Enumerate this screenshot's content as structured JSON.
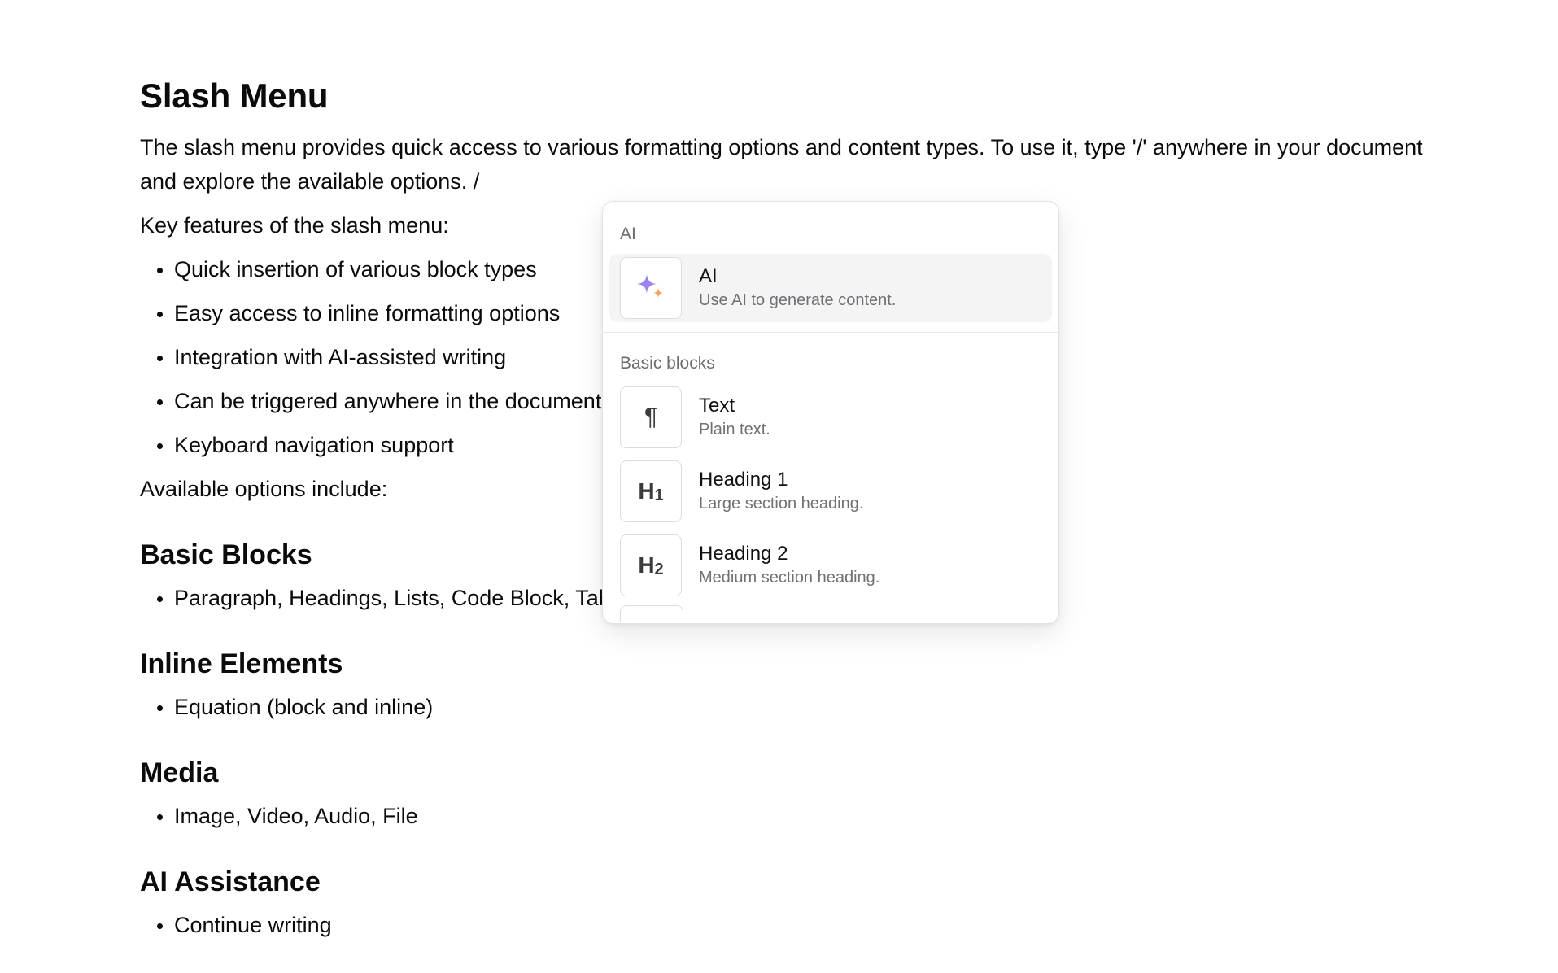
{
  "document": {
    "title": "Slash Menu",
    "intro": "The slash menu provides quick access to various formatting options and content types. To use it, type '/' anywhere in your document and explore the available options. /",
    "features_heading": "Key features of the slash menu:",
    "features": [
      "Quick insertion of various block types",
      "Easy access to inline formatting options",
      "Integration with AI-assisted writing",
      "Can be triggered anywhere in the document",
      "Keyboard navigation support"
    ],
    "options_heading": "Available options include:",
    "sections": [
      {
        "heading": "Basic Blocks",
        "items": [
          "Paragraph, Headings, Lists, Code Block, Table, Callout"
        ]
      },
      {
        "heading": "Inline Elements",
        "items": [
          "Equation (block and inline)"
        ]
      },
      {
        "heading": "Media",
        "items": [
          "Image, Video, Audio, File"
        ]
      },
      {
        "heading": "AI Assistance",
        "items": [
          "Continue writing"
        ]
      }
    ]
  },
  "slash_menu": {
    "groups": [
      {
        "label": "AI",
        "items": [
          {
            "icon": "ai-sparkle-icon",
            "title": "AI",
            "description": "Use AI to generate content.",
            "active": true
          }
        ]
      },
      {
        "label": "Basic blocks",
        "items": [
          {
            "icon": "paragraph-icon",
            "glyph": "¶",
            "title": "Text",
            "description": "Plain text."
          },
          {
            "icon": "heading-1-icon",
            "glyph": "H",
            "sub": "1",
            "title": "Heading 1",
            "description": "Large section heading."
          },
          {
            "icon": "heading-2-icon",
            "glyph": "H",
            "sub": "2",
            "title": "Heading 2",
            "description": "Medium section heading."
          }
        ]
      }
    ],
    "colors": {
      "active_bg": "#f4f4f5",
      "sparkle_purple": "#8b7cf6",
      "sparkle_orange": "#f5a35c"
    }
  }
}
